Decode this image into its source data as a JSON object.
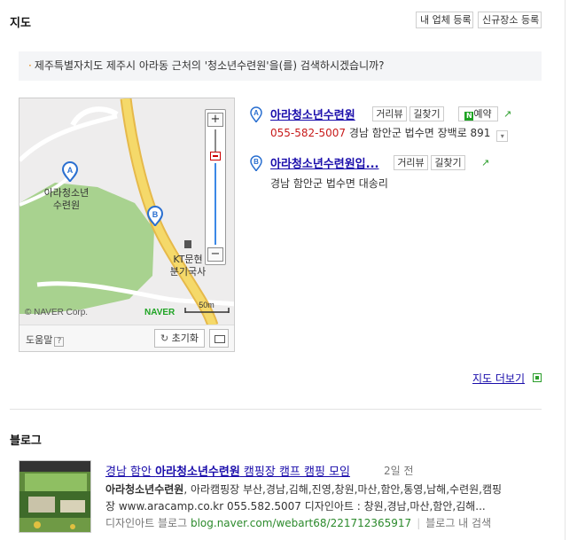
{
  "map_section": {
    "title": "지도",
    "register_business_label": "내 업체 등록",
    "register_place_label": "신규장소 등록",
    "notice_text": "제주특별자치도 제주시 아라동 근처의 '청소년수련원'을(를) 검색하시겠습니까?"
  },
  "map": {
    "attribution": "© NAVER Corp.",
    "logo": "NAVER",
    "scale_label": "50m",
    "zoom_in_label": "+",
    "zoom_out_label": "−",
    "markers": [
      {
        "letter": "A",
        "label_line1": "아라청소년",
        "label_line2": "수련원"
      },
      {
        "letter": "B"
      }
    ],
    "poi_label_line1": "KT문현",
    "poi_label_line2": "분기국사",
    "help_label": "도움말",
    "help_icon": "?",
    "reset_label": "초기화",
    "colors": {
      "land": "#eeeded",
      "park": "#a8d28f",
      "road": "#f5d96a",
      "road_edge": "#e6b94a"
    }
  },
  "results": [
    {
      "letter": "A",
      "name": "아라청소년수련원",
      "tags": [
        "거리뷰",
        "길찾기"
      ],
      "reserve_label": "예약",
      "phone": "055-582-5007",
      "address": "경남 함안군 법수면 장백로 891"
    },
    {
      "letter": "B",
      "name": "아라청소년수련원입...",
      "tags": [
        "거리뷰",
        "길찾기"
      ],
      "address": "경남 함안군 법수면 대송리"
    }
  ],
  "more_map_label": "지도 더보기",
  "blog_section": {
    "title": "블로그",
    "post": {
      "title_prefix": "경남 함안 ",
      "title_bold": "아라청소년수련원",
      "title_suffix": " 캠핑장 캠프 캠핑 모임",
      "date": "2일 전",
      "snippet_bold": "아라청소년수련원",
      "snippet_rest": ", 아라캠핑장 부산,경남,김해,진영,창원,마산,함안,통영,남해,수련원,캠핑",
      "snippet_line2": "장 www.aracamp.co.kr 055.582.5007 디자인아트 : 창원,경남,마산,함안,김해...",
      "blog_name": "디자인아트 블로그",
      "url": "blog.naver.com/webart68/221712365917",
      "search_in_blog": "블로그 내 검색"
    }
  }
}
